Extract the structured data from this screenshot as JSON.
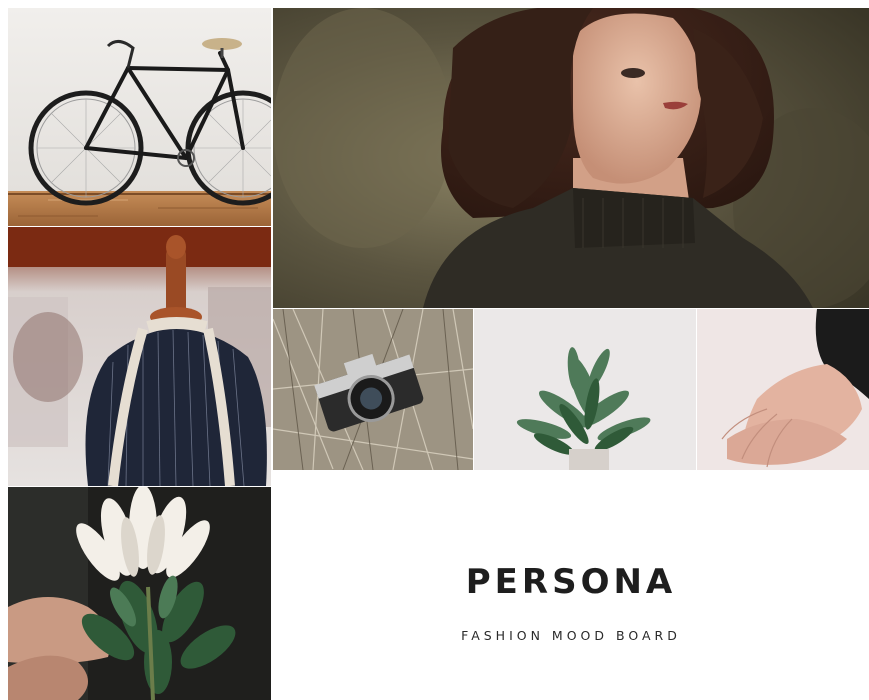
{
  "board": {
    "title": "PERSONA",
    "subtitle": "FASHION MOOD BOARD"
  },
  "photos": [
    {
      "subject": "bicycle-photo"
    },
    {
      "subject": "portrait-photo"
    },
    {
      "subject": "mannequin-photo"
    },
    {
      "subject": "camera-photo"
    },
    {
      "subject": "plant-photo"
    },
    {
      "subject": "hands-photo"
    },
    {
      "subject": "protea-flower-photo"
    }
  ],
  "colors": {
    "background": "#ffffff",
    "title_text": "#1e1e1e",
    "portrait_bg": "#5b5540",
    "sweater": "#2f2c25",
    "pinstripe_fabric": "#1f2638",
    "wall_red": "#7b2a12",
    "floor_wood": "#b77b48",
    "leaf_green": "#2f5a38"
  }
}
